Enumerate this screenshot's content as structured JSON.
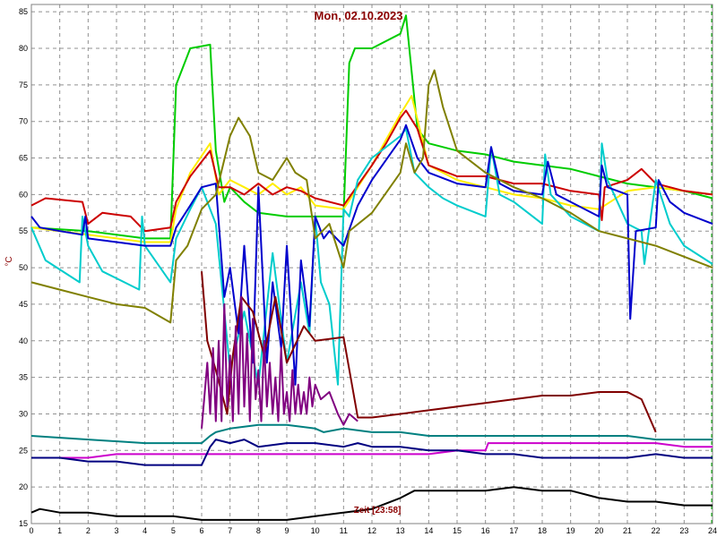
{
  "chart_data": {
    "type": "line",
    "title": "Mon, 02.10.2023",
    "ylabel": "°C",
    "time_label": "Zeit [23:58]",
    "xlim": [
      0,
      24
    ],
    "ylim": [
      15,
      86
    ],
    "x_ticks": [
      0,
      1,
      2,
      3,
      4,
      5,
      6,
      7,
      8,
      9,
      10,
      11,
      12,
      13,
      14,
      15,
      16,
      17,
      18,
      19,
      20,
      21,
      22,
      23,
      24
    ],
    "x_tick_labels": [
      "0",
      "1",
      "2",
      "3",
      "4",
      "5",
      "6",
      "7",
      "8",
      "9",
      "10",
      "11",
      "12",
      "13",
      "14",
      "15",
      "16",
      "17",
      "18",
      "19",
      "20",
      "21",
      "22",
      "23",
      "24"
    ],
    "y_ticks": [
      15,
      20,
      25,
      30,
      35,
      40,
      45,
      50,
      55,
      60,
      65,
      70,
      75,
      80,
      85
    ],
    "y_tick_labels": [
      "15",
      "20",
      "25",
      "30",
      "35",
      "40",
      "45",
      "50",
      "55",
      "60",
      "65",
      "70",
      "75",
      "80",
      "85"
    ],
    "grid": true,
    "series": [
      {
        "color": "#00cc00",
        "x": [
          0,
          2,
          4,
          4.9,
          5.1,
          5.6,
          6.3,
          6.5,
          6.8,
          7,
          7.5,
          8,
          9,
          10,
          11,
          11.2,
          11.4,
          12,
          13,
          13.2,
          13.6,
          14,
          15,
          16,
          17,
          18,
          19,
          20,
          21,
          22,
          23,
          24
        ],
        "y": [
          55.5,
          55,
          54,
          54,
          75,
          80,
          80.5,
          66,
          59,
          61,
          59,
          57.5,
          57,
          57,
          57,
          78,
          80,
          80,
          82,
          84.5,
          69,
          67,
          66,
          65.5,
          64.5,
          64,
          63.5,
          62.5,
          61.5,
          61,
          60.5,
          59.5
        ]
      },
      {
        "color": "#ffee00",
        "x": [
          0,
          2,
          4,
          4.9,
          5.1,
          5.6,
          6.3,
          6.6,
          7,
          7.5,
          8,
          8.5,
          9,
          9.5,
          10,
          11,
          12,
          12.5,
          13,
          13.4,
          14,
          15,
          16,
          17,
          18,
          19,
          20,
          21,
          22,
          23,
          24
        ],
        "y": [
          55.5,
          54.5,
          53.5,
          53.5,
          58,
          63,
          67,
          60,
          62,
          61,
          60,
          61.5,
          60,
          61,
          58.5,
          58,
          64,
          67.5,
          71,
          73.5,
          64,
          62,
          61,
          60,
          59.5,
          58.5,
          58,
          60.5,
          61,
          60.5,
          60
        ]
      },
      {
        "color": "#cc0000",
        "x": [
          0,
          0.5,
          1.8,
          2,
          2.5,
          3.5,
          4,
          4.9,
          5.1,
          5.6,
          6.3,
          6.6,
          7,
          7.5,
          8,
          8.5,
          9,
          9.5,
          10,
          11,
          12,
          12.5,
          13,
          13.2,
          13.6,
          14,
          15,
          16,
          17,
          18,
          19,
          20,
          20.1,
          20.2,
          21,
          21.5,
          22,
          23,
          24
        ],
        "y": [
          58.5,
          59.5,
          59,
          56,
          57.5,
          57,
          55,
          55.5,
          59,
          62.5,
          66,
          61,
          61,
          60,
          61.5,
          60,
          61,
          60.5,
          59.5,
          58.5,
          64,
          67,
          70.5,
          71.5,
          69,
          64,
          62.5,
          62.5,
          61.5,
          61.5,
          60.5,
          60,
          56.5,
          61,
          62,
          63.5,
          61.5,
          60.5,
          60
        ]
      },
      {
        "color": "#00cccc",
        "x": [
          0,
          0.5,
          1.7,
          1.8,
          2,
          2.5,
          3.8,
          3.9,
          4,
          4.9,
          5.1,
          5.6,
          6,
          6.5,
          7,
          7.5,
          8,
          8.5,
          9,
          9.5,
          9.8,
          10,
          10.2,
          10.5,
          10.8,
          11,
          11.2,
          11.5,
          12,
          13,
          13.2,
          13.5,
          14,
          14.5,
          15,
          16,
          16.2,
          16.5,
          17,
          18,
          18.1,
          18.3,
          19,
          20,
          20.1,
          20.3,
          21,
          21.5,
          21.6,
          22,
          22.5,
          23,
          24
        ],
        "y": [
          55.5,
          51,
          48,
          57,
          53,
          49.5,
          47,
          57,
          53,
          48,
          54,
          58,
          61,
          56,
          36,
          44,
          34,
          52,
          37,
          48,
          41,
          57,
          48,
          45,
          34,
          58,
          57,
          62,
          65,
          68,
          69,
          63,
          61,
          59.5,
          58.5,
          57,
          66.5,
          60,
          59,
          56,
          65.5,
          60,
          57,
          55,
          67,
          62,
          56,
          55,
          50.5,
          62,
          56,
          53,
          50.5
        ]
      },
      {
        "color": "#0000cc",
        "x": [
          0,
          0.3,
          1,
          1.8,
          1.9,
          2,
          3,
          4,
          4.9,
          5.1,
          5.6,
          6,
          6.5,
          6.8,
          7,
          7.3,
          7.5,
          7.8,
          8,
          8.3,
          8.5,
          8.8,
          9,
          9.3,
          9.5,
          9.8,
          10,
          10.3,
          10.5,
          11,
          11.5,
          12,
          13,
          13.2,
          13.6,
          14,
          15,
          16,
          16.2,
          16.5,
          17,
          18,
          18.2,
          18.5,
          19,
          20,
          20.1,
          20.3,
          21,
          21.1,
          21.3,
          22,
          22.1,
          22.5,
          23,
          24
        ],
        "y": [
          57,
          55.5,
          55,
          54.5,
          57,
          54,
          53.5,
          53,
          53,
          55.5,
          58.5,
          61,
          61.5,
          46,
          50,
          41,
          53,
          37,
          61,
          37,
          48,
          39,
          53,
          34,
          51,
          42,
          57,
          54,
          55,
          53,
          58.5,
          62,
          67.5,
          69.5,
          65,
          63,
          61.5,
          61,
          66.5,
          61.5,
          60.5,
          60,
          64.5,
          60,
          59,
          57,
          64,
          61,
          60,
          43,
          55,
          55.5,
          62,
          59,
          57.5,
          56
        ]
      },
      {
        "color": "#808000",
        "x": [
          0,
          0.5,
          1,
          2,
          3,
          4,
          4.9,
          5.1,
          5.5,
          6,
          6.5,
          7,
          7.3,
          7.7,
          8,
          8.5,
          9,
          9.3,
          9.7,
          10,
          10.5,
          11,
          11.2,
          12,
          13,
          13.2,
          13.5,
          13.8,
          14,
          14.2,
          14.5,
          15,
          16,
          17,
          18,
          19,
          20,
          21,
          22,
          23,
          24
        ],
        "y": [
          48,
          47.5,
          47,
          46,
          45,
          44.5,
          42.5,
          51,
          53,
          58,
          60,
          68,
          70.5,
          68,
          63,
          62,
          65,
          63,
          62,
          54,
          56,
          50,
          55,
          57.5,
          63,
          67,
          63,
          65,
          75,
          77,
          72,
          66,
          63,
          61,
          59.5,
          57.5,
          55,
          54,
          53,
          51.5,
          50
        ]
      },
      {
        "color": "#800000",
        "x": [
          6,
          6.2,
          6.5,
          6.9,
          7.1,
          7.4,
          7.8,
          8.2,
          8.6,
          9,
          9.6,
          10,
          11,
          11.5,
          12,
          13,
          14,
          15,
          16,
          17,
          18,
          19,
          20,
          21,
          21.5,
          22
        ],
        "y": [
          49.5,
          40,
          36,
          30,
          38,
          46,
          44,
          38,
          46,
          37,
          42,
          40,
          40.5,
          29.5,
          29.5,
          30,
          30.5,
          31,
          31.5,
          32,
          32.5,
          32.5,
          33,
          33,
          32,
          27.5
        ]
      },
      {
        "color": "#800080",
        "x": [
          6,
          6.2,
          6.3,
          6.4,
          6.5,
          6.6,
          6.7,
          6.8,
          6.9,
          7,
          7.1,
          7.2,
          7.3,
          7.4,
          7.5,
          7.6,
          7.7,
          7.8,
          7.9,
          8,
          8.1,
          8.2,
          8.3,
          8.4,
          8.5,
          8.6,
          8.7,
          8.8,
          8.9,
          9,
          9.1,
          9.2,
          9.3,
          9.4,
          9.5,
          9.6,
          9.7,
          9.8,
          9.9,
          10,
          10.2,
          10.5,
          10.8,
          11,
          11.2,
          11.5
        ],
        "y": [
          28,
          37,
          30,
          39,
          29,
          40,
          29,
          45,
          31,
          38,
          29,
          42,
          30,
          46,
          31,
          41,
          29,
          43,
          32,
          36,
          29,
          40,
          31,
          37,
          30,
          35,
          29,
          39,
          30,
          33,
          29,
          36,
          30,
          34,
          30,
          33,
          30,
          35,
          31,
          34,
          32,
          33,
          30,
          28.5,
          30,
          29
        ]
      },
      {
        "color": "#008080",
        "x": [
          0,
          2,
          4,
          6,
          6.3,
          6.5,
          7,
          8,
          9,
          10,
          10.3,
          11,
          12,
          13,
          14,
          15,
          16,
          17,
          18,
          19,
          20,
          21,
          22,
          23,
          24
        ],
        "y": [
          27,
          26.5,
          26,
          26,
          27,
          27.5,
          28,
          28.5,
          28.5,
          28,
          27.5,
          28,
          27.5,
          27.5,
          27,
          27,
          27,
          27,
          27,
          27,
          27,
          27,
          26.5,
          26.5,
          26.5
        ]
      },
      {
        "color": "#cc00cc",
        "x": [
          0,
          2,
          3,
          4,
          5,
          6,
          7,
          8,
          9,
          10,
          11,
          12,
          13,
          14,
          15,
          16,
          16.1,
          17,
          18,
          19,
          20,
          21,
          22,
          23,
          24
        ],
        "y": [
          24,
          24,
          24.5,
          24.5,
          24.5,
          24.5,
          24.5,
          24.5,
          24.5,
          24.5,
          24.5,
          24.5,
          24.5,
          24.5,
          25,
          25,
          26,
          26,
          26,
          26,
          26,
          26,
          26,
          25.5,
          25.5
        ]
      },
      {
        "color": "#000080",
        "x": [
          0,
          1,
          2,
          3,
          4,
          5,
          6,
          6.3,
          6.5,
          7,
          7.5,
          8,
          9,
          10,
          11,
          11.5,
          12,
          13,
          14,
          15,
          16,
          17,
          18,
          19,
          20,
          21,
          22,
          23,
          24
        ],
        "y": [
          24,
          24,
          23.5,
          23.5,
          23,
          23,
          23,
          25.5,
          26.5,
          26,
          26.5,
          25.5,
          26,
          26,
          25.5,
          26,
          25.5,
          25.5,
          25,
          25,
          24.5,
          24.5,
          24,
          24,
          24,
          24,
          24.5,
          24,
          24
        ]
      },
      {
        "color": "#000000",
        "x": [
          0,
          0.3,
          1,
          2,
          3,
          4,
          5,
          6,
          7,
          8,
          9,
          10,
          11,
          12,
          13,
          13.5,
          14,
          15,
          16,
          17,
          18,
          19,
          20,
          21,
          22,
          23,
          24
        ],
        "y": [
          16.5,
          17,
          16.5,
          16.5,
          16,
          16,
          16,
          15.5,
          15.5,
          15.5,
          15.5,
          16,
          16.5,
          17,
          18.5,
          19.5,
          19.5,
          19.5,
          19.5,
          20,
          19.5,
          19.5,
          18.5,
          18,
          18,
          17.5,
          17.5
        ]
      }
    ]
  }
}
